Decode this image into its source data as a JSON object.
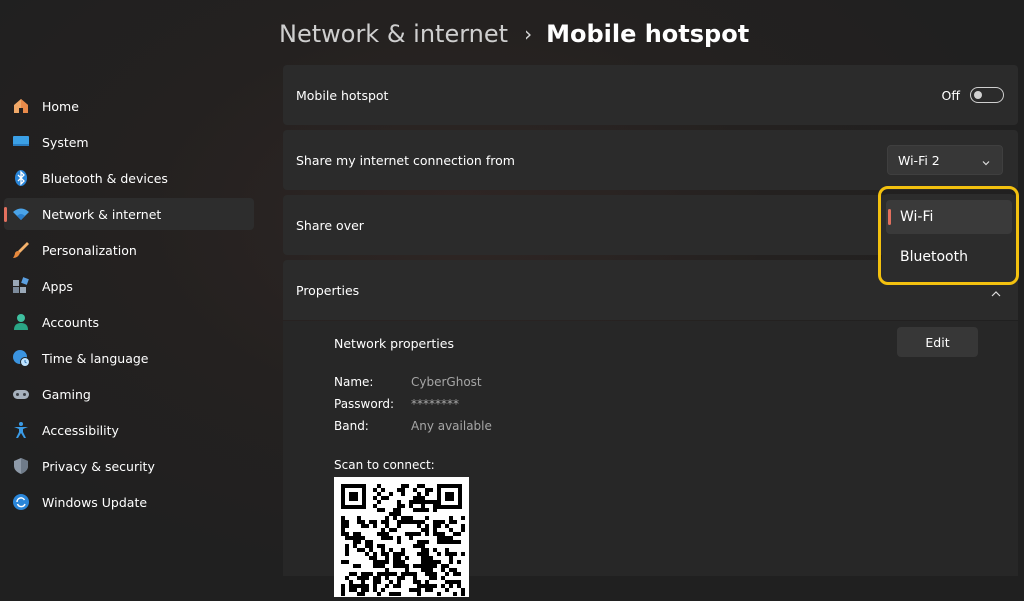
{
  "header": {
    "parent": "Network & internet",
    "separator": "›",
    "current": "Mobile hotspot"
  },
  "sidebar": {
    "items": [
      {
        "label": "Home",
        "icon": "home-icon"
      },
      {
        "label": "System",
        "icon": "display-icon"
      },
      {
        "label": "Bluetooth & devices",
        "icon": "bluetooth-icon"
      },
      {
        "label": "Network & internet",
        "icon": "wifi-icon",
        "active": true
      },
      {
        "label": "Personalization",
        "icon": "brush-icon"
      },
      {
        "label": "Apps",
        "icon": "apps-icon"
      },
      {
        "label": "Accounts",
        "icon": "person-icon"
      },
      {
        "label": "Time & language",
        "icon": "globe-clock-icon"
      },
      {
        "label": "Gaming",
        "icon": "gamepad-icon"
      },
      {
        "label": "Accessibility",
        "icon": "accessibility-icon"
      },
      {
        "label": "Privacy & security",
        "icon": "shield-icon"
      },
      {
        "label": "Windows Update",
        "icon": "update-icon"
      }
    ]
  },
  "main": {
    "hotspot": {
      "label": "Mobile hotspot",
      "state_text": "Off",
      "on": false
    },
    "share_from": {
      "label": "Share my internet connection from",
      "value": "Wi-Fi 2"
    },
    "share_over": {
      "label": "Share over"
    },
    "properties": {
      "label": "Properties",
      "network_properties_label": "Network properties",
      "edit_label": "Edit",
      "rows": [
        {
          "key": "Name:",
          "value": "CyberGhost"
        },
        {
          "key": "Password:",
          "value": "********"
        },
        {
          "key": "Band:",
          "value": "Any available"
        }
      ],
      "scan_label": "Scan to connect:"
    }
  },
  "flyout": {
    "options": [
      {
        "label": "Wi-Fi",
        "selected": true
      },
      {
        "label": "Bluetooth",
        "selected": false
      }
    ]
  },
  "colors": {
    "accent": "#e3705e",
    "highlight": "#f3c10f",
    "background": "#202020",
    "card": "#2b2b2b"
  }
}
